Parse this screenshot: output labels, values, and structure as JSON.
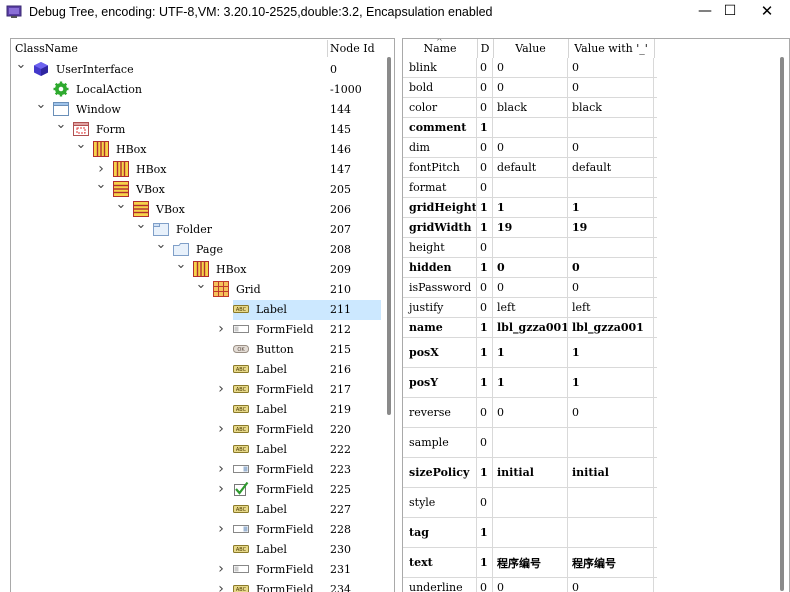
{
  "window": {
    "title": "Debug Tree, encoding: UTF-8,VM: 3.20.10-2525,double:3.2, Encapsulation enabled",
    "minimize": "—",
    "maximize": "☐",
    "close": "✕"
  },
  "tree": {
    "columns": {
      "classname": "ClassName",
      "node_id": "Node Id"
    },
    "rows": [
      {
        "name": "UserInterface",
        "id": "0",
        "icon": "cube-icon",
        "chevron": "down",
        "depth": 0
      },
      {
        "name": "LocalAction",
        "id": "-1000",
        "icon": "gear-icon",
        "chevron": "",
        "depth": 1
      },
      {
        "name": "Window",
        "id": "144",
        "icon": "window-icon",
        "chevron": "down",
        "depth": 1
      },
      {
        "name": "Form",
        "id": "145",
        "icon": "form-icon",
        "chevron": "down",
        "depth": 2
      },
      {
        "name": "HBox",
        "id": "146",
        "icon": "hbox-icon",
        "chevron": "down",
        "depth": 3
      },
      {
        "name": "HBox",
        "id": "147",
        "icon": "hbox-icon",
        "chevron": "right",
        "depth": 4
      },
      {
        "name": "VBox",
        "id": "205",
        "icon": "vbox-icon",
        "chevron": "down",
        "depth": 4
      },
      {
        "name": "VBox",
        "id": "206",
        "icon": "vbox-icon",
        "chevron": "down",
        "depth": 5
      },
      {
        "name": "Folder",
        "id": "207",
        "icon": "folder-icon",
        "chevron": "down",
        "depth": 6
      },
      {
        "name": "Page",
        "id": "208",
        "icon": "page-folder-icon",
        "chevron": "down",
        "depth": 7
      },
      {
        "name": "HBox",
        "id": "209",
        "icon": "hbox-icon",
        "chevron": "down",
        "depth": 8
      },
      {
        "name": "Grid",
        "id": "210",
        "icon": "grid-icon",
        "chevron": "down",
        "depth": 9
      },
      {
        "name": "Label",
        "id": "211",
        "icon": "label-icon",
        "chevron": "",
        "depth": 10,
        "selected": true
      },
      {
        "name": "FormField",
        "id": "212",
        "icon": "formfield-icon",
        "chevron": "right",
        "depth": 10
      },
      {
        "name": "Button",
        "id": "215",
        "icon": "button-icon",
        "chevron": "",
        "depth": 10
      },
      {
        "name": "Label",
        "id": "216",
        "icon": "label-icon",
        "chevron": "",
        "depth": 10
      },
      {
        "name": "FormField",
        "id": "217",
        "icon": "label-icon",
        "chevron": "right",
        "depth": 10
      },
      {
        "name": "Label",
        "id": "219",
        "icon": "label-icon",
        "chevron": "",
        "depth": 10
      },
      {
        "name": "FormField",
        "id": "220",
        "icon": "label-icon",
        "chevron": "right",
        "depth": 10
      },
      {
        "name": "Label",
        "id": "222",
        "icon": "label-icon",
        "chevron": "",
        "depth": 10
      },
      {
        "name": "FormField",
        "id": "223",
        "icon": "combo-icon",
        "chevron": "right",
        "depth": 10
      },
      {
        "name": "FormField",
        "id": "225",
        "icon": "checkbox-icon",
        "chevron": "right",
        "depth": 10
      },
      {
        "name": "Label",
        "id": "227",
        "icon": "label-icon",
        "chevron": "",
        "depth": 10
      },
      {
        "name": "FormField",
        "id": "228",
        "icon": "combo-icon",
        "chevron": "right",
        "depth": 10
      },
      {
        "name": "Label",
        "id": "230",
        "icon": "label-icon",
        "chevron": "",
        "depth": 10
      },
      {
        "name": "FormField",
        "id": "231",
        "icon": "formfield-icon",
        "chevron": "right",
        "depth": 10
      },
      {
        "name": "FormField",
        "id": "234",
        "icon": "label-icon",
        "chevron": "right",
        "depth": 10
      }
    ]
  },
  "grid": {
    "columns": {
      "name": "Name",
      "d": "D",
      "value": "Value",
      "value_u": "Value with '_'"
    },
    "rows": [
      {
        "name": "blink",
        "d": "0",
        "value": "0",
        "value_u": "0",
        "bold": false,
        "h": 20
      },
      {
        "name": "bold",
        "d": "0",
        "value": "0",
        "value_u": "0",
        "bold": false,
        "h": 20
      },
      {
        "name": "color",
        "d": "0",
        "value": "black",
        "value_u": "black",
        "bold": false,
        "h": 20
      },
      {
        "name": "comment",
        "d": "1",
        "value": "",
        "value_u": "",
        "bold": true,
        "h": 20
      },
      {
        "name": "dim",
        "d": "0",
        "value": "0",
        "value_u": "0",
        "bold": false,
        "h": 20
      },
      {
        "name": "fontPitch",
        "d": "0",
        "value": "default",
        "value_u": "default",
        "bold": false,
        "h": 20
      },
      {
        "name": "format",
        "d": "0",
        "value": "",
        "value_u": "",
        "bold": false,
        "h": 20
      },
      {
        "name": "gridHeight",
        "d": "1",
        "value": "1",
        "value_u": "1",
        "bold": true,
        "h": 20
      },
      {
        "name": "gridWidth",
        "d": "1",
        "value": "19",
        "value_u": "19",
        "bold": true,
        "h": 20
      },
      {
        "name": "height",
        "d": "0",
        "value": "",
        "value_u": "",
        "bold": false,
        "h": 20
      },
      {
        "name": "hidden",
        "d": "1",
        "value": "0",
        "value_u": "0",
        "bold": true,
        "h": 20
      },
      {
        "name": "isPassword",
        "d": "0",
        "value": "0",
        "value_u": "0",
        "bold": false,
        "h": 20
      },
      {
        "name": "justify",
        "d": "0",
        "value": "left",
        "value_u": "left",
        "bold": false,
        "h": 20
      },
      {
        "name": "name",
        "d": "1",
        "value": "lbl_gzza001",
        "value_u": "lbl_gzza001",
        "bold": true,
        "h": 20
      },
      {
        "name": "posX",
        "d": "1",
        "value": "1",
        "value_u": "1",
        "bold": true,
        "h": 30
      },
      {
        "name": "posY",
        "d": "1",
        "value": "1",
        "value_u": "1",
        "bold": true,
        "h": 30
      },
      {
        "name": "reverse",
        "d": "0",
        "value": "0",
        "value_u": "0",
        "bold": false,
        "h": 30
      },
      {
        "name": "sample",
        "d": "0",
        "value": "",
        "value_u": "",
        "bold": false,
        "h": 30
      },
      {
        "name": "sizePolicy",
        "d": "1",
        "value": "initial",
        "value_u": "initial",
        "bold": true,
        "h": 30
      },
      {
        "name": "style",
        "d": "0",
        "value": "",
        "value_u": "",
        "bold": false,
        "h": 30
      },
      {
        "name": "tag",
        "d": "1",
        "value": "",
        "value_u": "",
        "bold": true,
        "h": 30
      },
      {
        "name": "text",
        "d": "1",
        "value": "程序编号",
        "value_u": "程序编号",
        "bold": true,
        "h": 30
      },
      {
        "name": "underline",
        "d": "0",
        "value": "0",
        "value_u": "0",
        "bold": false,
        "h": 20
      }
    ]
  },
  "colors": {
    "selection": "#cce8ff",
    "border": "#a9a9a9",
    "gridline": "#d9d9d9"
  }
}
